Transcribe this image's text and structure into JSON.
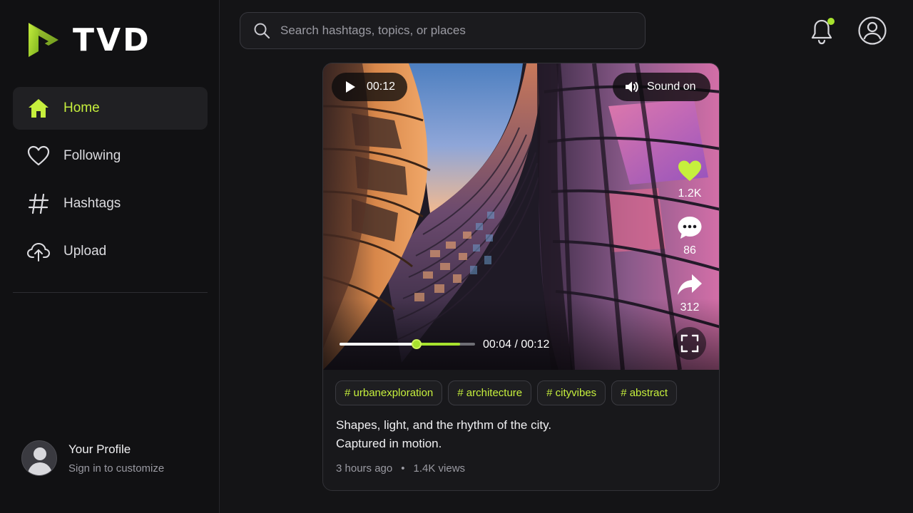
{
  "app": {
    "brand": "TVD",
    "accent_color": "#a7e22e"
  },
  "sidebar": {
    "items": [
      {
        "label": "Home",
        "icon": "home-icon",
        "active": true
      },
      {
        "label": "Following",
        "icon": "heart-outline-icon",
        "active": false
      },
      {
        "label": "Hashtags",
        "icon": "hashtag-icon",
        "active": false
      },
      {
        "label": "Upload",
        "icon": "cloud-upload-icon",
        "active": false
      }
    ],
    "profile": {
      "name": "Your Profile",
      "subtitle": "Sign in to customize"
    }
  },
  "header": {
    "search_placeholder": "Search hashtags, topics, or places",
    "search_value": "",
    "notification_badge": true
  },
  "post": {
    "duration_badge": "00:12",
    "sound_label": "Sound on",
    "likes": "1.2K",
    "comments": "86",
    "shares": "312",
    "progress_fraction": 0.57,
    "timecode": "00:04 / 00:12",
    "tags": [
      "# urbanexploration",
      "# architecture",
      "# cityvibes",
      "# abstract"
    ],
    "caption_line1": "Shapes, light, and the rhythm of the city.",
    "caption_line2": "Captured in motion.",
    "posted": "3 hours ago",
    "views": "1.4K views",
    "separator": "•"
  }
}
